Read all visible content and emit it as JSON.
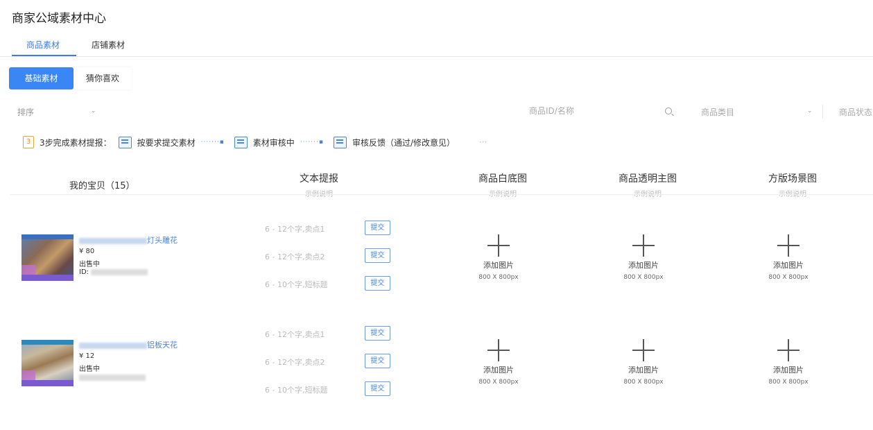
{
  "page_title": "商家公域素材中心",
  "tabs": [
    {
      "label": "商品素材",
      "active": true
    },
    {
      "label": "店铺素材",
      "active": false
    }
  ],
  "segments": [
    {
      "label": "基础素材",
      "active": true
    },
    {
      "label": "猜你喜欢",
      "active": false
    }
  ],
  "filters": {
    "sort_label": "排序",
    "search_placeholder": "商品ID/名称",
    "category_label": "商品类目",
    "status_label": "商品状态"
  },
  "steps": {
    "badge": "3",
    "intro": "3步完成素材提报：",
    "step1": "按要求提交素材",
    "step2": "素材审核中",
    "step3": "审核反馈（通过/修改意见）",
    "more": "···"
  },
  "columns": {
    "my_items": "我的宝贝（15）",
    "text": {
      "title": "文本提报",
      "sub": "示例说明"
    },
    "white_bg": {
      "title": "商品白底图",
      "sub": "示例说明"
    },
    "transparent": {
      "title": "商品透明主图",
      "sub": "示例说明"
    },
    "square_scene": {
      "title": "方版场景图",
      "sub": "示例说明"
    }
  },
  "text_fields": [
    "6 - 12个字,卖点1",
    "6 - 12个字,卖点2",
    "6 - 10个字,短标题"
  ],
  "submit_label": "提交",
  "upload": {
    "label": "添加图片",
    "size": "800 X 800px"
  },
  "products": [
    {
      "title_suffix": "灯头雕花",
      "price": "¥ 80",
      "status": "出售中",
      "id_label": "ID:"
    },
    {
      "title_suffix": "铝板天花",
      "price": "¥ 12",
      "status": "出售中",
      "id_label": ""
    }
  ],
  "colors": {
    "accent": "#3a86f5",
    "link": "#4a86d8",
    "step_badge": "#f08a20"
  }
}
